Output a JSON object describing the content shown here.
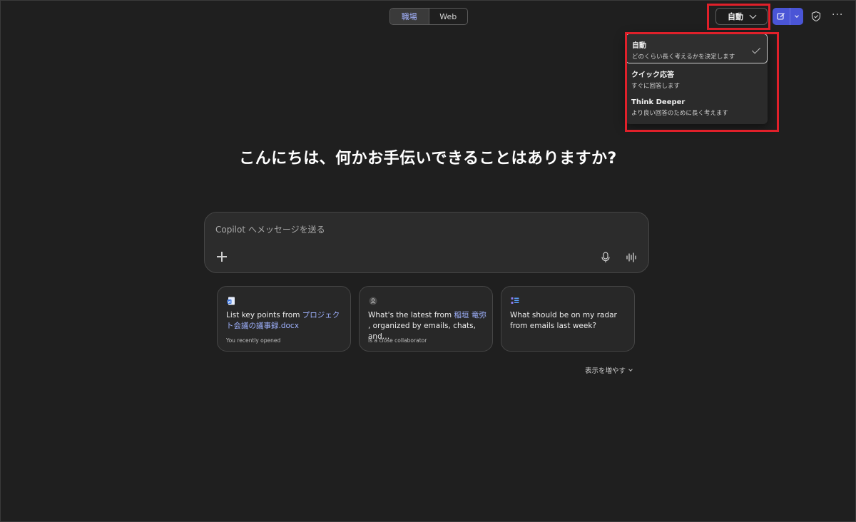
{
  "toggle": {
    "work_label": "職場",
    "web_label": "Web"
  },
  "mode_button": {
    "label": "自動"
  },
  "menu": {
    "items": [
      {
        "title": "自動",
        "desc": "どのくらい長く考えるかを決定します",
        "selected": true
      },
      {
        "title": "クイック応答",
        "desc": "すぐに回答します",
        "selected": false
      },
      {
        "title": "Think Deeper",
        "desc": "より良い回答のために長く考えます",
        "selected": false
      }
    ]
  },
  "heading": "こんにちは、何かお手伝いできることはありますか?",
  "composer": {
    "placeholder": "Copilot へメッセージを送る"
  },
  "cards": [
    {
      "prefix": "List key points from ",
      "highlight": "プロジェクト会議の議事録.docx",
      "suffix": "",
      "sub": "You recently opened",
      "icon": "word-doc-icon"
    },
    {
      "prefix": "What's the latest from ",
      "highlight": "稲垣 竜弥",
      "suffix": " , organized by emails, chats, and…",
      "sub": "Is a close collaborator",
      "icon": "person-icon"
    },
    {
      "prefix": "What should be on my radar from emails last week?",
      "highlight": "",
      "suffix": "",
      "sub": "",
      "icon": "list-icon"
    }
  ],
  "show_more": "表示を増やす",
  "colors": {
    "accent": "#4a55d6",
    "highlight_box": "#e0202a",
    "link": "#9fb2ff"
  }
}
